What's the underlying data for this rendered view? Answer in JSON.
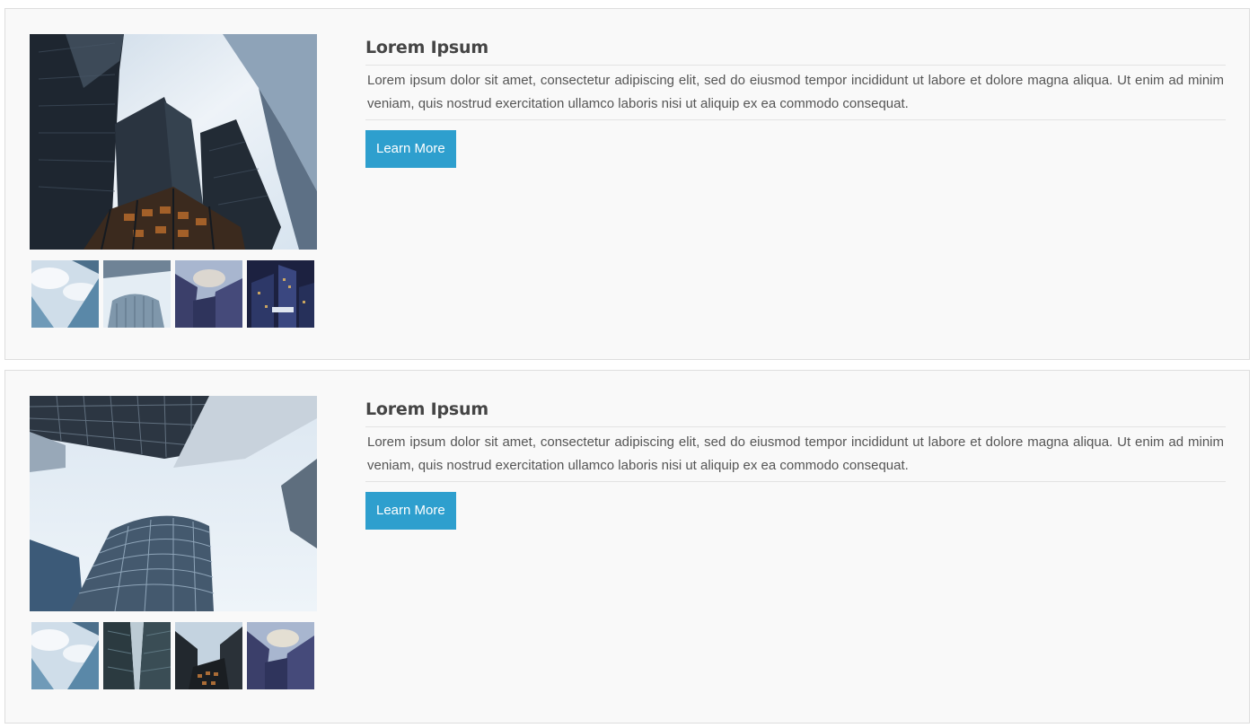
{
  "cards": [
    {
      "title": "Lorem Ipsum",
      "description": "Lorem ipsum dolor sit amet, consectetur adipiscing elit, sed do eiusmod tempor incididunt ut labore et dolore magna aliqua. Ut enim ad minim veniam, quis nostrud exercitation ullamco laboris nisi ut aliquip ex ea commodo consequat.",
      "button_label": "Learn More",
      "main_image": "skyscrapers-looking-up-photo",
      "thumbnails": [
        "glass-tower-sky-photo",
        "round-tower-sky-photo",
        "blue-towers-photo",
        "night-city-lights-photo"
      ]
    },
    {
      "title": "Lorem Ipsum",
      "description": "Lorem ipsum dolor sit amet, consectetur adipiscing elit, sed do eiusmod tempor incididunt ut labore et dolore magna aliqua. Ut enim ad minim veniam, quis nostrud exercitation ullamco laboris nisi ut aliquip ex ea commodo consequat.",
      "button_label": "Learn More",
      "main_image": "cylindrical-tower-sky-photo",
      "thumbnails": [
        "glass-tower-sky-photo",
        "dark-glass-towers-photo",
        "twin-towers-lit-photo",
        "blue-towers-photo"
      ]
    }
  ],
  "colors": {
    "button": "#2e9fce",
    "card_background": "#f9f9f9",
    "title_text": "#454545",
    "body_text": "#555555"
  }
}
